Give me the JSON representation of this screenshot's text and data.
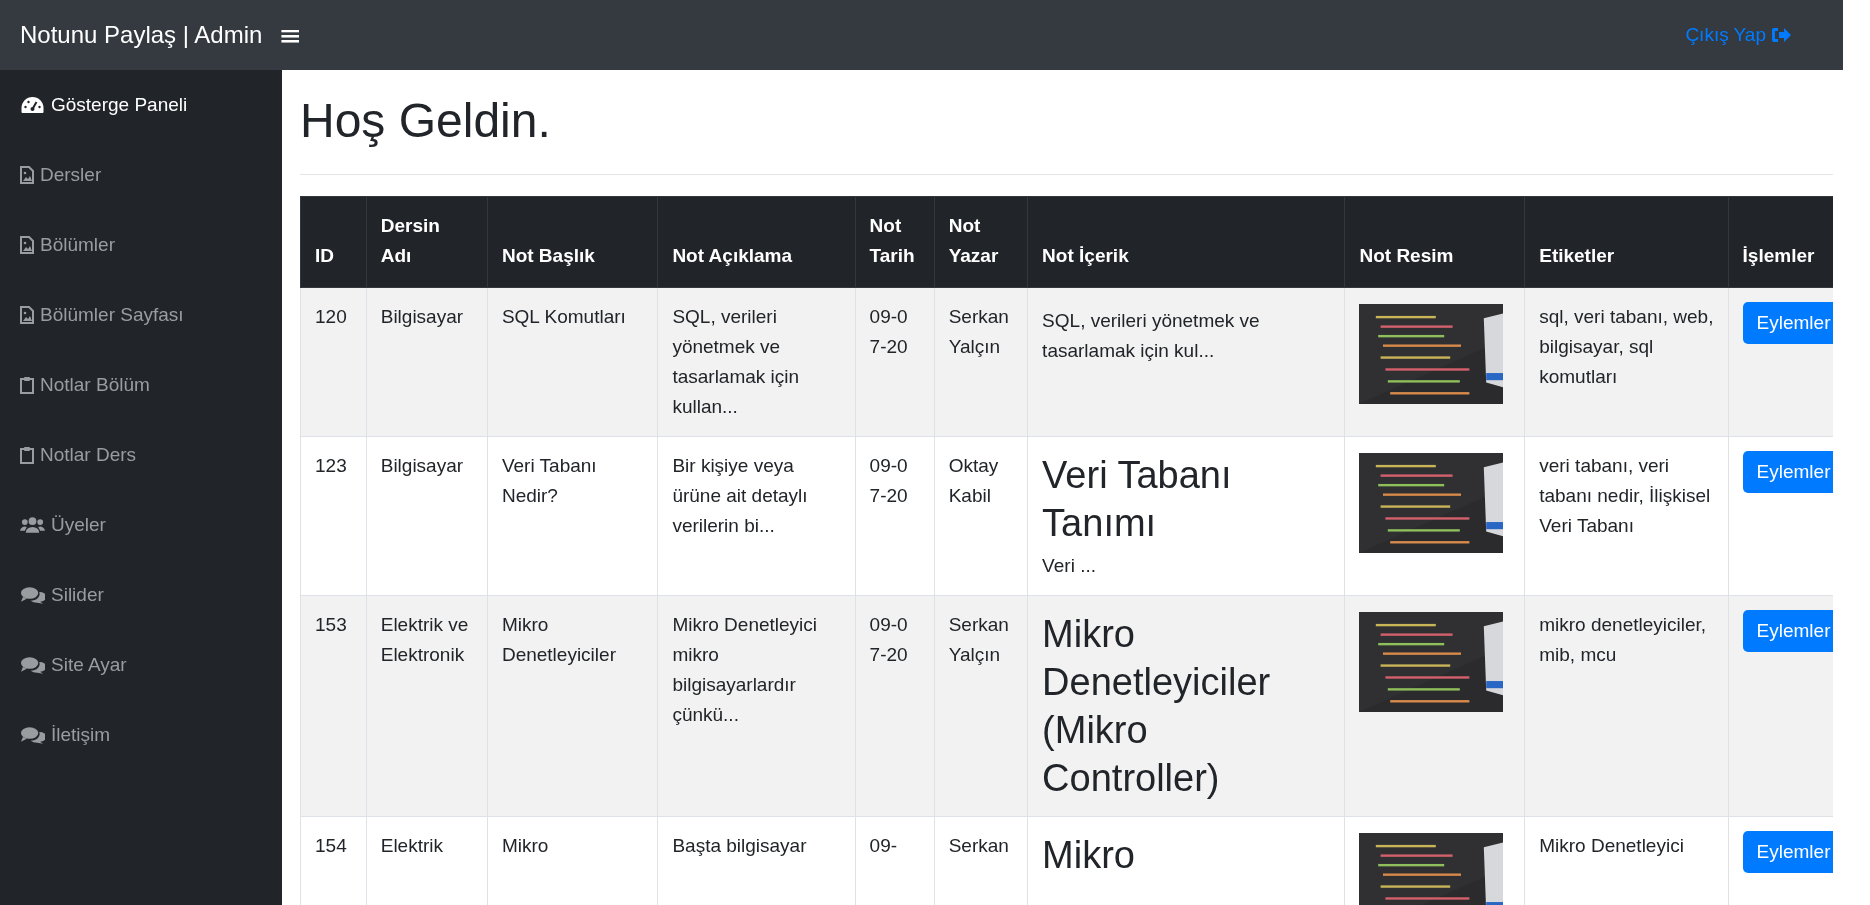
{
  "navbar": {
    "brand": "Notunu Paylaş | Admin",
    "menu_toggle": "≡",
    "logout": "Çıkış Yap"
  },
  "sidebar": {
    "items": [
      {
        "label": "Gösterge Paneli",
        "kind": "gauge",
        "selected": true
      },
      {
        "label": "Dersler",
        "kind": "file",
        "selected": false
      },
      {
        "label": "Bölümler",
        "kind": "file",
        "selected": false
      },
      {
        "label": "Bölümler Sayfası",
        "kind": "file",
        "selected": false
      },
      {
        "label": "Notlar Bölüm",
        "kind": "clipboard",
        "selected": false
      },
      {
        "label": "Notlar Ders",
        "kind": "clipboard",
        "selected": false
      },
      {
        "label": "Üyeler",
        "kind": "users",
        "selected": false
      },
      {
        "label": "Silider",
        "kind": "comments",
        "selected": false
      },
      {
        "label": "Site Ayar",
        "kind": "comments",
        "selected": false
      },
      {
        "label": "İletişim",
        "kind": "comments",
        "selected": false
      }
    ]
  },
  "page_title": "Hoş Geldin.",
  "table": {
    "columns": [
      "ID",
      "Dersin Adı",
      "Not Başlık",
      "Not Açıklama",
      "Not Tarih",
      "Not Yazar",
      "Not İçerik",
      "Not Resim",
      "Etiketler",
      "İşlemler"
    ],
    "rows": [
      {
        "id": "120",
        "course": "Bilgisayar",
        "title": "SQL Komutları",
        "description": "SQL, verileri yönetmek ve tasarlamak için kullan...",
        "date": "09-07-20",
        "author": "Serkan Yalçın",
        "content": [
          {
            "kind": "text",
            "text": "SQL, verileri yönetmek ve tasarlamak için kul..."
          }
        ],
        "tags": "sql, veri tabanı, web, bilgisayar, sql komutları",
        "action": "Eylemler"
      },
      {
        "id": "123",
        "course": "Bilgisayar",
        "title": "Veri Tabanı Nedir?",
        "description": "Bir kişiye veya ürüne ait detaylı verilerin bi...",
        "date": "09-07-20",
        "author": "Oktay Kabil",
        "content": [
          {
            "kind": "heading",
            "text": " Veri Tabanı Tanımı"
          },
          {
            "kind": "text",
            "text": "Veri ..."
          }
        ],
        "tags": "veri tabanı, veri tabanı nedir, İlişkisel Veri Tabanı",
        "action": "Eylemler"
      },
      {
        "id": "153",
        "course": "Elektrik ve Elektronik",
        "title": "Mikro Denetleyiciler",
        "description": "Mikro Denetleyici mikro bilgisayarlardır çünkü...",
        "date": "09-07-20",
        "author": "Serkan Yalçın",
        "content": [
          {
            "kind": "heading",
            "text": "Mikro Denetleyiciler (Mikro Controller)"
          }
        ],
        "tags": "mikro denetleyiciler, mib, mcu",
        "action": "Eylemler"
      },
      {
        "id": "154",
        "course": "Elektrik",
        "title": "Mikro",
        "description": "Başta bilgisayar",
        "date": "09-",
        "author": "Serkan",
        "content": [
          {
            "kind": "heading",
            "text": "Mikro"
          }
        ],
        "tags": "Mikro Denetleyici",
        "action": "Eylemler"
      }
    ]
  }
}
